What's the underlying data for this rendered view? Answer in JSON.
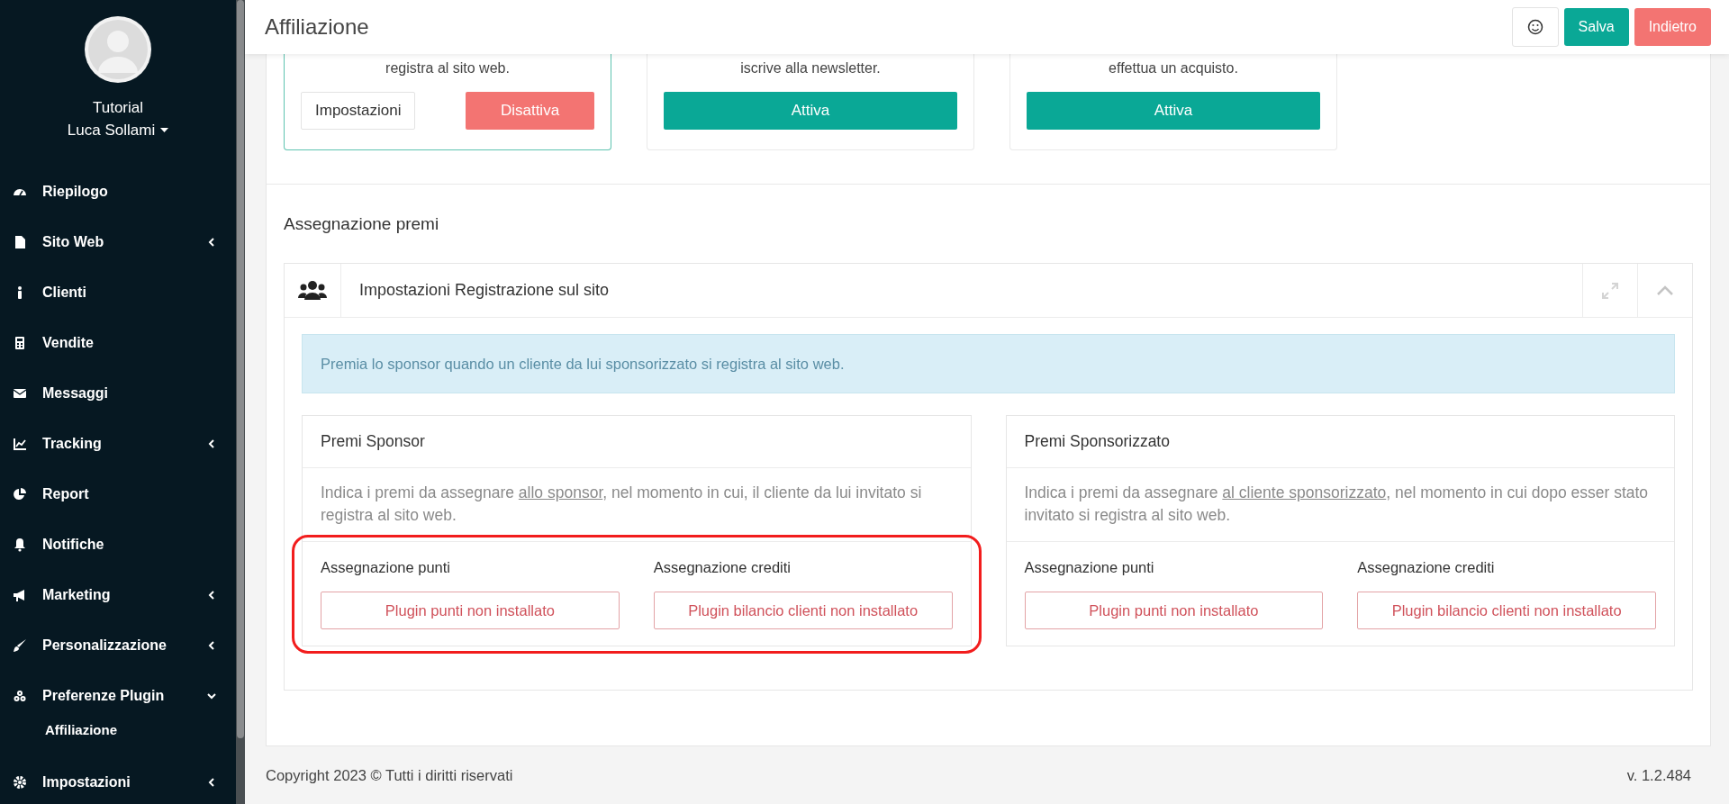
{
  "sidebar": {
    "user": {
      "line1": "Tutorial",
      "line2": "Luca Sollami"
    },
    "items": [
      {
        "label": "Riepilogo",
        "kind": "link"
      },
      {
        "label": "Sito Web",
        "kind": "group",
        "expanded": false
      },
      {
        "label": "Clienti",
        "kind": "link"
      },
      {
        "label": "Vendite",
        "kind": "link"
      },
      {
        "label": "Messaggi",
        "kind": "link"
      },
      {
        "label": "Tracking",
        "kind": "group",
        "expanded": false
      },
      {
        "label": "Report",
        "kind": "link"
      },
      {
        "label": "Notifiche",
        "kind": "link"
      },
      {
        "label": "Marketing",
        "kind": "group",
        "expanded": false
      },
      {
        "label": "Personalizzazione",
        "kind": "group",
        "expanded": false
      },
      {
        "label": "Preferenze Plugin",
        "kind": "group",
        "expanded": true,
        "children": [
          {
            "label": "Affiliazione"
          }
        ]
      },
      {
        "label": "Impostazioni",
        "kind": "group",
        "expanded": false
      }
    ]
  },
  "header": {
    "title": "Affiliazione",
    "buttons": [
      {
        "label": "Salva",
        "kind": "save"
      },
      {
        "label": "Indietro",
        "kind": "back"
      }
    ]
  },
  "program_cards": [
    {
      "description": "registra al sito web.",
      "active": true,
      "settings_button": "Impostazioni",
      "toggle_button": "Disattiva"
    },
    {
      "description": "iscrive alla newsletter.",
      "active": false,
      "toggle_button": "Attiva"
    },
    {
      "description": "effettua un acquisto.",
      "active": false,
      "toggle_button": "Attiva"
    }
  ],
  "section_title": "Assegnazione premi",
  "settings_box": {
    "title": "Impostazioni Registrazione sul sito",
    "expanded": true,
    "alert": "Premia lo sponsor quando un cliente da lui sponsorizzato si registra al sito web.",
    "panels": [
      {
        "title": "Premi Sponsor",
        "description_before": "Indica i premi da assegnare ",
        "description_link": "allo sponsor",
        "description_after": ", nel momento in cui, il cliente da lui invitato si registra al sito web.",
        "highlighted": true,
        "fields": [
          {
            "label": "Assegnazione punti",
            "status": "Plugin punti non installato"
          },
          {
            "label": "Assegnazione crediti",
            "status": "Plugin bilancio clienti non installato"
          }
        ]
      },
      {
        "title": "Premi Sponsorizzato",
        "description_before": "Indica i premi da assegnare ",
        "description_link": "al cliente sponsorizzato",
        "description_after": ", nel momento in cui dopo esser stato invitato si registra al sito web.",
        "highlighted": false,
        "fields": [
          {
            "label": "Assegnazione punti",
            "status": "Plugin punti non installato"
          },
          {
            "label": "Assegnazione crediti",
            "status": "Plugin bilancio clienti non installato"
          }
        ]
      }
    ]
  },
  "footer": {
    "copyright": "Copyright 2023 © Tutti i diritti riservati",
    "version": "v. 1.2.484"
  }
}
